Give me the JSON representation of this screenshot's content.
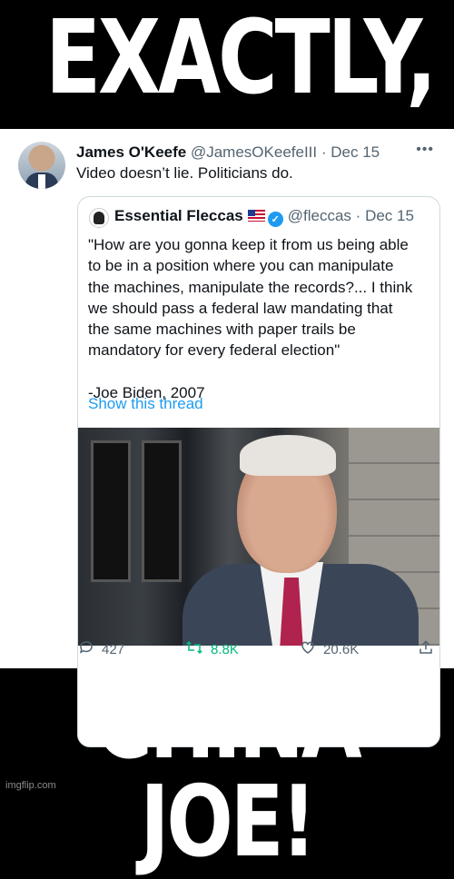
{
  "meme": {
    "top_text": "EXACTLY,",
    "bottom_text": "CHINA JOE!",
    "watermark": "imgflip.com"
  },
  "tweet": {
    "author_name": "James O'Keefe",
    "handle": "@JamesOKeefeIII",
    "separator": "·",
    "date": "Dec 15",
    "text": "Video doesn’t lie. Politicians do.",
    "more_icon": "•••",
    "quote": {
      "author_name": "Essential Fleccas",
      "handle": "@fleccas",
      "separator": "·",
      "date": "Dec 15",
      "verified_glyph": "✓",
      "body_lines": [
        "\"How are you gonna keep it from us being able",
        "to be in a position where you can manipulate",
        "the machines, manipulate the records?... I think",
        "we should pass a federal law mandating that",
        "the same machines with paper trails be",
        "mandatory for every federal election\""
      ],
      "signature": "-Joe Biden, 2007",
      "show_thread": "Show this thread"
    },
    "actions": {
      "replies": "427",
      "retweets": "8.8K",
      "likes": "20.6K"
    }
  },
  "colors": {
    "accent_blue": "#1d9bf0",
    "retweet_green": "#00ba7c",
    "meta_gray": "#536471"
  }
}
